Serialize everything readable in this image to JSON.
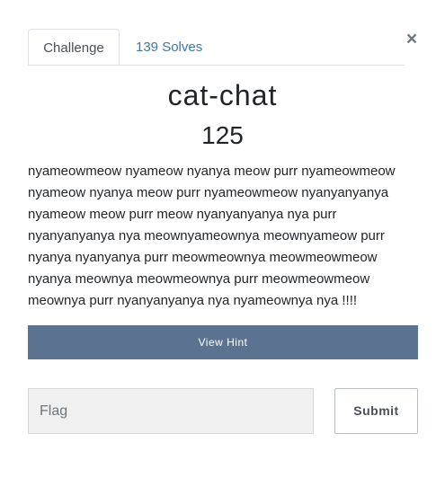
{
  "tabs": {
    "challenge_label": "Challenge",
    "solves_label": "139 Solves"
  },
  "close_symbol": "×",
  "challenge": {
    "name": "cat-chat",
    "points": "125",
    "description": "nyameowmeow nyameow nyanya meow purr nyameowmeow nyameow nyanya meow purr nyameowmeow nyanyanyanya nyameow meow purr meow nyanyanyanya nya purr nyanyanyanya nya meownyameownya meownyameow purr nyanya nyanyanya purr meowmeownya meowmeowmeow nyanya meownya meowmeownya purr meowmeowmeow meownya purr nyanyanyanya nya nyameownya nya !!!!"
  },
  "hint": {
    "label": "View Hint"
  },
  "flag_form": {
    "placeholder": "Flag",
    "value": "",
    "submit_label": "Submit"
  },
  "colors": {
    "hint_button_bg": "#5b7290",
    "tab_link": "#3c78a8",
    "input_bg": "#f0f0f0"
  }
}
